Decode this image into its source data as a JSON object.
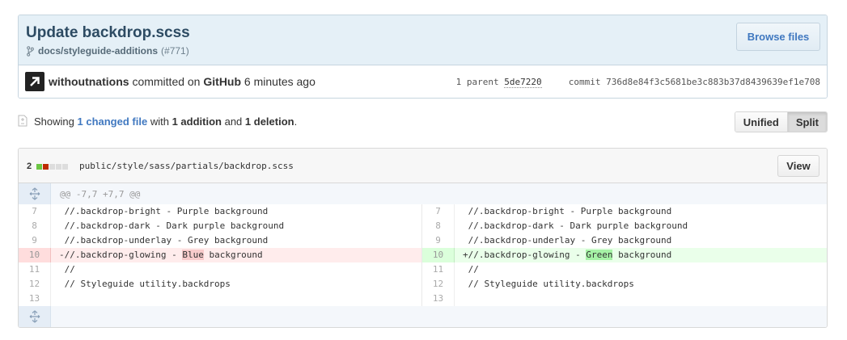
{
  "commit": {
    "title": "Update backdrop.scss",
    "branch_icon": "git-branch-icon",
    "branch": "docs/styleguide-additions",
    "pr_number": "(#771)",
    "browse_label": "Browse files",
    "avatar_icon": "arrow-up-right-icon",
    "author": "withoutnations",
    "committed_on": "committed on",
    "committer": "GitHub",
    "time_ago": "6 minutes ago",
    "parent_label": "1 parent",
    "parent_sha": "5de7220",
    "commit_label": "commit",
    "commit_sha": "736d8e84f3c5681be3c883b37d8439639ef1e708"
  },
  "toc": {
    "icon": "file-diff-icon",
    "showing": "Showing",
    "changed_link": "1 changed file",
    "with": "with",
    "additions": "1 addition",
    "and": "and",
    "deletions": "1 deletion",
    "period": ".",
    "unified_label": "Unified",
    "split_label": "Split",
    "selected_mode": "Split"
  },
  "file": {
    "change_count": "2",
    "path": "public/style/sass/partials/backdrop.scss",
    "view_label": "View",
    "colors": {
      "addition": "#6cc644",
      "deletion": "#bd2c00"
    },
    "hunk_header": "@@ -7,7 +7,7 @@",
    "expand_icon": "unfold-icon",
    "lines": [
      {
        "left_num": "7",
        "left_code": " //.backdrop-bright - Purple background",
        "right_num": "7",
        "right_code": " //.backdrop-bright - Purple background",
        "type": "context"
      },
      {
        "left_num": "8",
        "left_code": " //.backdrop-dark - Dark purple background",
        "right_num": "8",
        "right_code": " //.backdrop-dark - Dark purple background",
        "type": "context"
      },
      {
        "left_num": "9",
        "left_code": " //.backdrop-underlay - Grey background",
        "right_num": "9",
        "right_code": " //.backdrop-underlay - Grey background",
        "type": "context"
      },
      {
        "left_num": "10",
        "left_prefix": "-//.backdrop-glowing - ",
        "left_word": "Blue",
        "left_suffix": " background",
        "right_num": "10",
        "right_prefix": "+//.backdrop-glowing - ",
        "right_word": "Green",
        "right_suffix": " background",
        "type": "change"
      },
      {
        "left_num": "11",
        "left_code": " //",
        "right_num": "11",
        "right_code": " //",
        "type": "context"
      },
      {
        "left_num": "12",
        "left_code": " // Styleguide utility.backdrops",
        "right_num": "12",
        "right_code": " // Styleguide utility.backdrops",
        "type": "context"
      },
      {
        "left_num": "13",
        "left_code": "",
        "right_num": "13",
        "right_code": "",
        "type": "context"
      }
    ]
  }
}
